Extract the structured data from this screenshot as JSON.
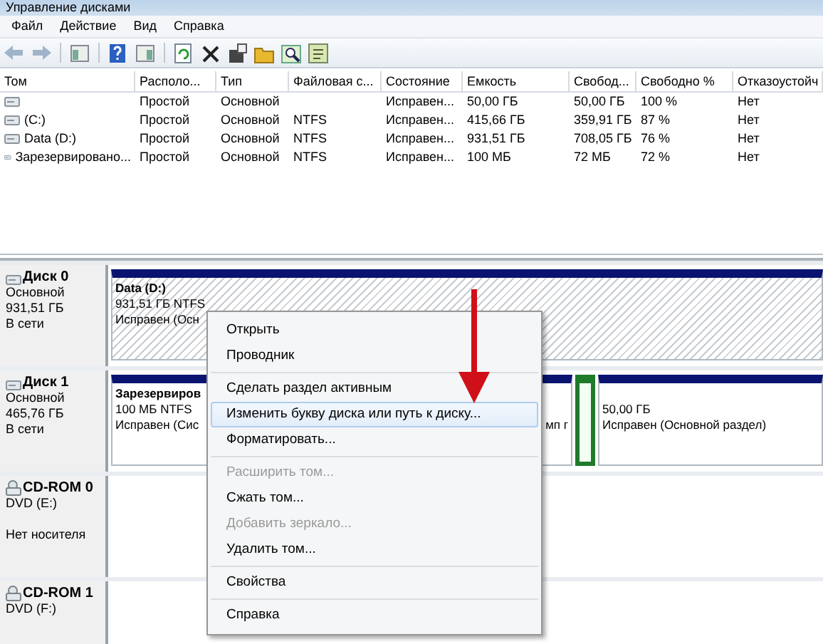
{
  "window": {
    "title": "Управление дисками"
  },
  "menu": [
    "Файл",
    "Действие",
    "Вид",
    "Справка"
  ],
  "table": {
    "columns": [
      "Том",
      "Располо...",
      "Тип",
      "Файловая с...",
      "Состояние",
      "Емкость",
      "Свобод...",
      "Свободно %",
      "Отказоустойч"
    ],
    "rows": [
      [
        "",
        "Простой",
        "Основной",
        "",
        "Исправен...",
        "50,00 ГБ",
        "50,00 ГБ",
        "100 %",
        "Нет"
      ],
      [
        "(C:)",
        "Простой",
        "Основной",
        "NTFS",
        "Исправен...",
        "415,66 ГБ",
        "359,91 ГБ",
        "87 %",
        "Нет"
      ],
      [
        "Data (D:)",
        "Простой",
        "Основной",
        "NTFS",
        "Исправен...",
        "931,51 ГБ",
        "708,05 ГБ",
        "76 %",
        "Нет"
      ],
      [
        "Зарезервировано...",
        "Простой",
        "Основной",
        "NTFS",
        "Исправен...",
        "100 МБ",
        "72 МБ",
        "72 %",
        "Нет"
      ]
    ]
  },
  "disks": [
    {
      "kind": "hdd",
      "name": "Диск 0",
      "type": "Основной",
      "size": "931,51 ГБ",
      "status": "В сети",
      "partitions": [
        {
          "kind": "volume",
          "selected": true,
          "name": "Data (D:)",
          "size": "931,51 ГБ NTFS",
          "status": "Исправен (Осн"
        }
      ]
    },
    {
      "kind": "hdd",
      "name": "Диск 1",
      "type": "Основной",
      "size": "465,76 ГБ",
      "status": "В сети",
      "partitions": [
        {
          "kind": "volume",
          "selected": false,
          "name": "Зарезервиров",
          "size": "100 МБ NTFS",
          "status": "Исправен (Сис"
        },
        {
          "kind": "volume",
          "selected": false,
          "status": "мп г"
        },
        {
          "kind": "sliver",
          "selected": true
        },
        {
          "kind": "volume",
          "selected": false,
          "size": "50,00 ГБ",
          "status": "Исправен (Основной раздел)"
        }
      ]
    },
    {
      "kind": "cdrom",
      "name": "CD-ROM 0",
      "type": "DVD (E:)",
      "status": "Нет носителя"
    },
    {
      "kind": "cdrom",
      "name": "CD-ROM 1",
      "type": "DVD (F:)"
    }
  ],
  "context_menu": [
    [
      {
        "label": "Открыть",
        "disabled": false,
        "selected": false
      },
      {
        "label": "Проводник",
        "disabled": false,
        "selected": false
      }
    ],
    [
      {
        "label": "Сделать раздел активным",
        "disabled": false,
        "selected": false
      },
      {
        "label": "Изменить букву диска или путь к диску...",
        "disabled": false,
        "selected": true
      },
      {
        "label": "Форматировать...",
        "disabled": false,
        "selected": false
      }
    ],
    [
      {
        "label": "Расширить том...",
        "disabled": true,
        "selected": false
      },
      {
        "label": "Сжать том...",
        "disabled": false,
        "selected": false
      },
      {
        "label": "Добавить зеркало...",
        "disabled": true,
        "selected": false
      },
      {
        "label": "Удалить том...",
        "disabled": false,
        "selected": false
      }
    ],
    [
      {
        "label": "Свойства",
        "disabled": false,
        "selected": false
      }
    ],
    [
      {
        "label": "Справка",
        "disabled": false,
        "selected": false
      }
    ]
  ]
}
